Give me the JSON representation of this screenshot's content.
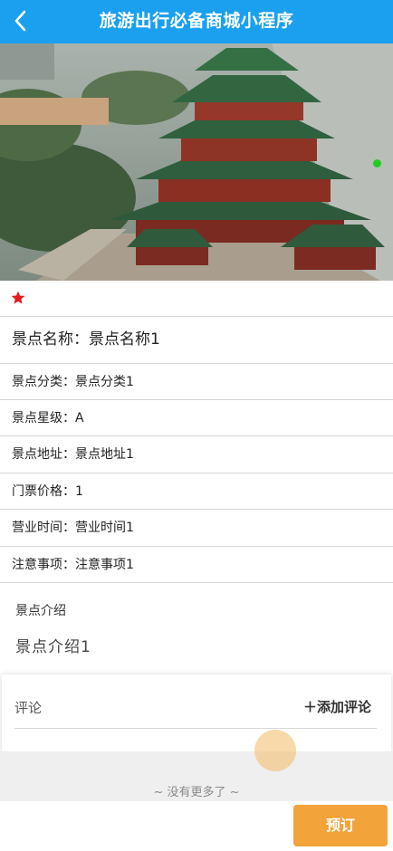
{
  "header": {
    "title": "旅游出行必备商城小程序"
  },
  "details": {
    "name": {
      "label": "景点名称：",
      "value": "景点名称1"
    },
    "category": {
      "label": "景点分类：",
      "value": "景点分类1"
    },
    "rating": {
      "label": "景点星级：",
      "value": "A"
    },
    "address": {
      "label": "景点地址：",
      "value": "景点地址1"
    },
    "price": {
      "label": "门票价格：",
      "value": "1"
    },
    "hours": {
      "label": "营业时间：",
      "value": "营业时间1"
    },
    "notes": {
      "label": "注意事项：",
      "value": "注意事项1"
    }
  },
  "intro": {
    "title": "景点介绍",
    "text": "景点介绍1"
  },
  "comments": {
    "label": "评论",
    "add_label": "＋添加评论"
  },
  "footer": {
    "no_more": "~ 没有更多了 ~",
    "book_label": "预订"
  },
  "colors": {
    "header": "#1aa0ef",
    "accent": "#f2a33a",
    "star": "#e8181c"
  },
  "icons": {
    "back": "chevron-left-icon",
    "favorite": "star-icon"
  }
}
